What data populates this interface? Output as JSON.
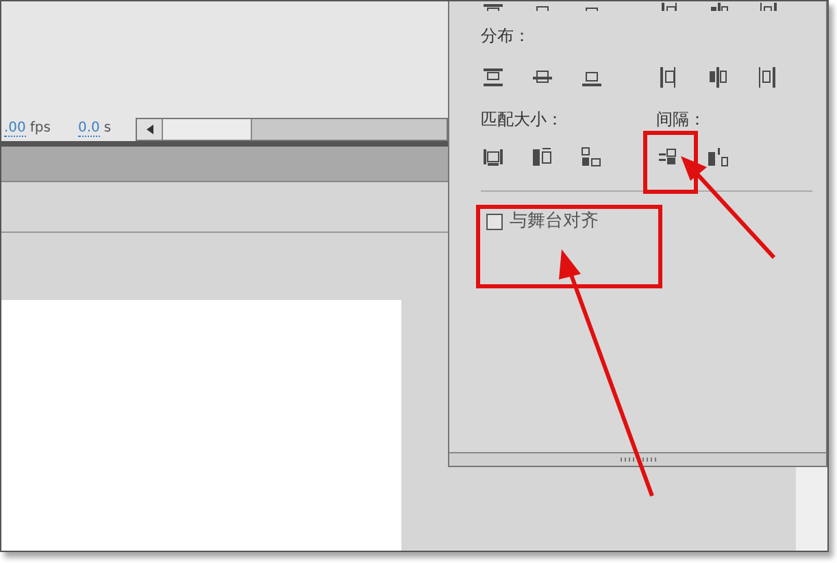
{
  "timeline": {
    "frame_rate": ".00",
    "frame_rate_unit": "fps",
    "time": "0.0",
    "time_unit": "s"
  },
  "align_panel": {
    "distribute_label": "分布：",
    "match_size_label": "匹配大小：",
    "spacing_label": "间隔：",
    "align_to_stage": {
      "label": "与舞台对齐",
      "checked": false
    }
  }
}
